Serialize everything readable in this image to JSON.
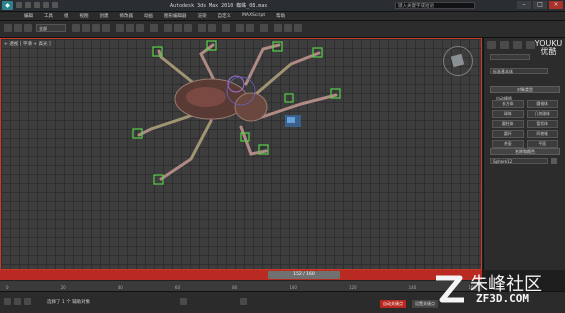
{
  "window": {
    "title": "Autodesk 3ds Max  2010    蜘蛛_08.max",
    "search_placeholder": "键入关键字或短语"
  },
  "menu": [
    "编辑",
    "工具",
    "组",
    "视图",
    "创建",
    "修改器",
    "动画",
    "图形编辑器",
    "渲染",
    "自定义",
    "MAXScript",
    "帮助"
  ],
  "toolbar": {
    "selection_filter": "全部"
  },
  "viewport": {
    "label": "+ 透视 [ 平滑 + 高光 ]",
    "grid_color": "#2f2f2f",
    "background": "#3d3d3d",
    "active_border_color": "#c83a2a"
  },
  "command_panel": {
    "dropdown": "标准基本体",
    "rollout_object_type": "对象类型",
    "autogrid_label": "自动栅格",
    "objects": [
      "长方体",
      "圆锥体",
      "球体",
      "几何球体",
      "圆柱体",
      "管状体",
      "圆环",
      "四棱锥",
      "茶壶",
      "平面"
    ],
    "rollout_name_color": "名称和颜色",
    "name_value": "Sphere12"
  },
  "timeline": {
    "slider_label": "152 / 160",
    "ticks": [
      "0",
      "20",
      "40",
      "60",
      "80",
      "100",
      "120",
      "140",
      "160"
    ]
  },
  "status": {
    "message": "选择了 1 个 辅助对象",
    "autokey_label": "自动关键点",
    "setkey_label": "设置关键点"
  },
  "watermarks": {
    "youku": "YOUKU 优酷",
    "brand_cn": "朱峰社区",
    "brand_en": "ZF3D.COM"
  }
}
